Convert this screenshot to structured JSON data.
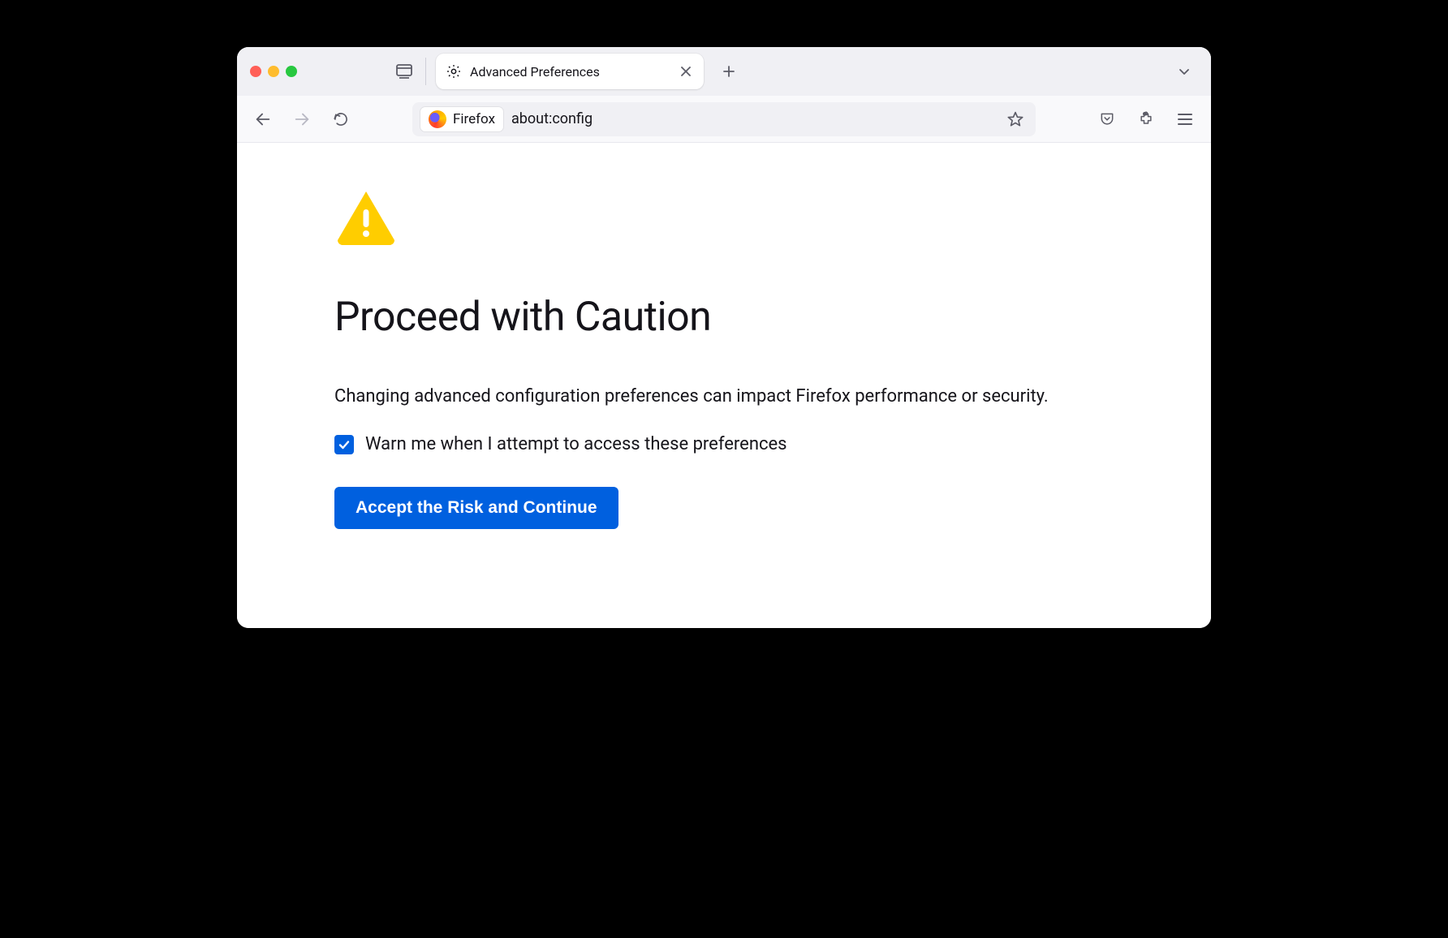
{
  "tab": {
    "title": "Advanced Preferences"
  },
  "urlbar": {
    "identity_label": "Firefox",
    "url": "about:config"
  },
  "page": {
    "heading": "Proceed with Caution",
    "description": "Changing advanced configuration preferences can impact Firefox performance or security.",
    "checkbox_label": "Warn me when I attempt to access these preferences",
    "checkbox_checked": true,
    "accept_button": "Accept the Risk and Continue"
  },
  "icons": {
    "sidebar": "sidebar-icon",
    "gear": "gear-icon",
    "close": "close-icon",
    "plus": "plus-icon",
    "chevron_down": "chevron-down-icon",
    "back": "arrow-left-icon",
    "forward": "arrow-right-icon",
    "reload": "reload-icon",
    "star": "star-icon",
    "pocket": "pocket-icon",
    "extensions": "puzzle-icon",
    "menu": "hamburger-icon",
    "warning": "warning-triangle-icon",
    "check": "check-icon"
  },
  "colors": {
    "accent": "#0060df",
    "warning": "#ffcd00"
  }
}
